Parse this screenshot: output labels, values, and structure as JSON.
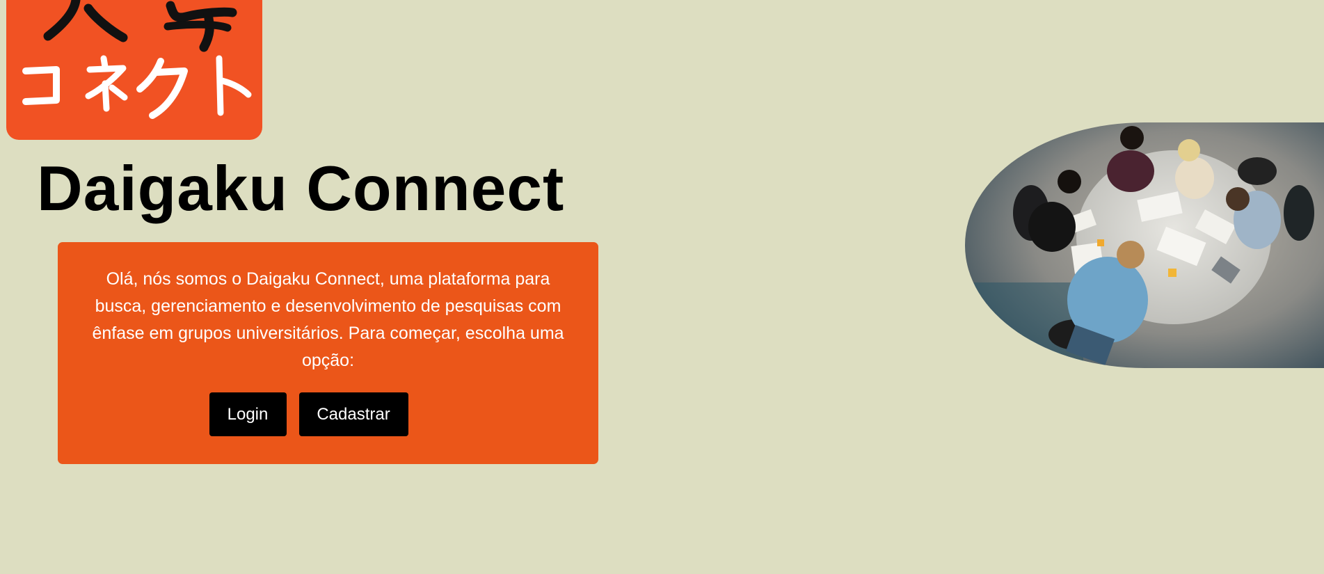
{
  "logo": {
    "kana_text": "コネクト",
    "kanji_text": "大学",
    "background_color": "#f15223"
  },
  "header": {
    "title": "Daigaku Connect"
  },
  "intro": {
    "text": "Olá, nós somos o Daigaku Connect, uma plataforma para busca, gerenciamento e desenvolvimento de pesquisas com ênfase em grupos universitários. Para começar, escolha uma opção:",
    "login_label": "Login",
    "register_label": "Cadastrar",
    "card_color": "#eb5619"
  },
  "hero_image": {
    "subject": "students-studying-around-table-photo"
  },
  "colors": {
    "page_background": "#dddec1",
    "button_background": "#000000",
    "button_text": "#ffffff"
  }
}
